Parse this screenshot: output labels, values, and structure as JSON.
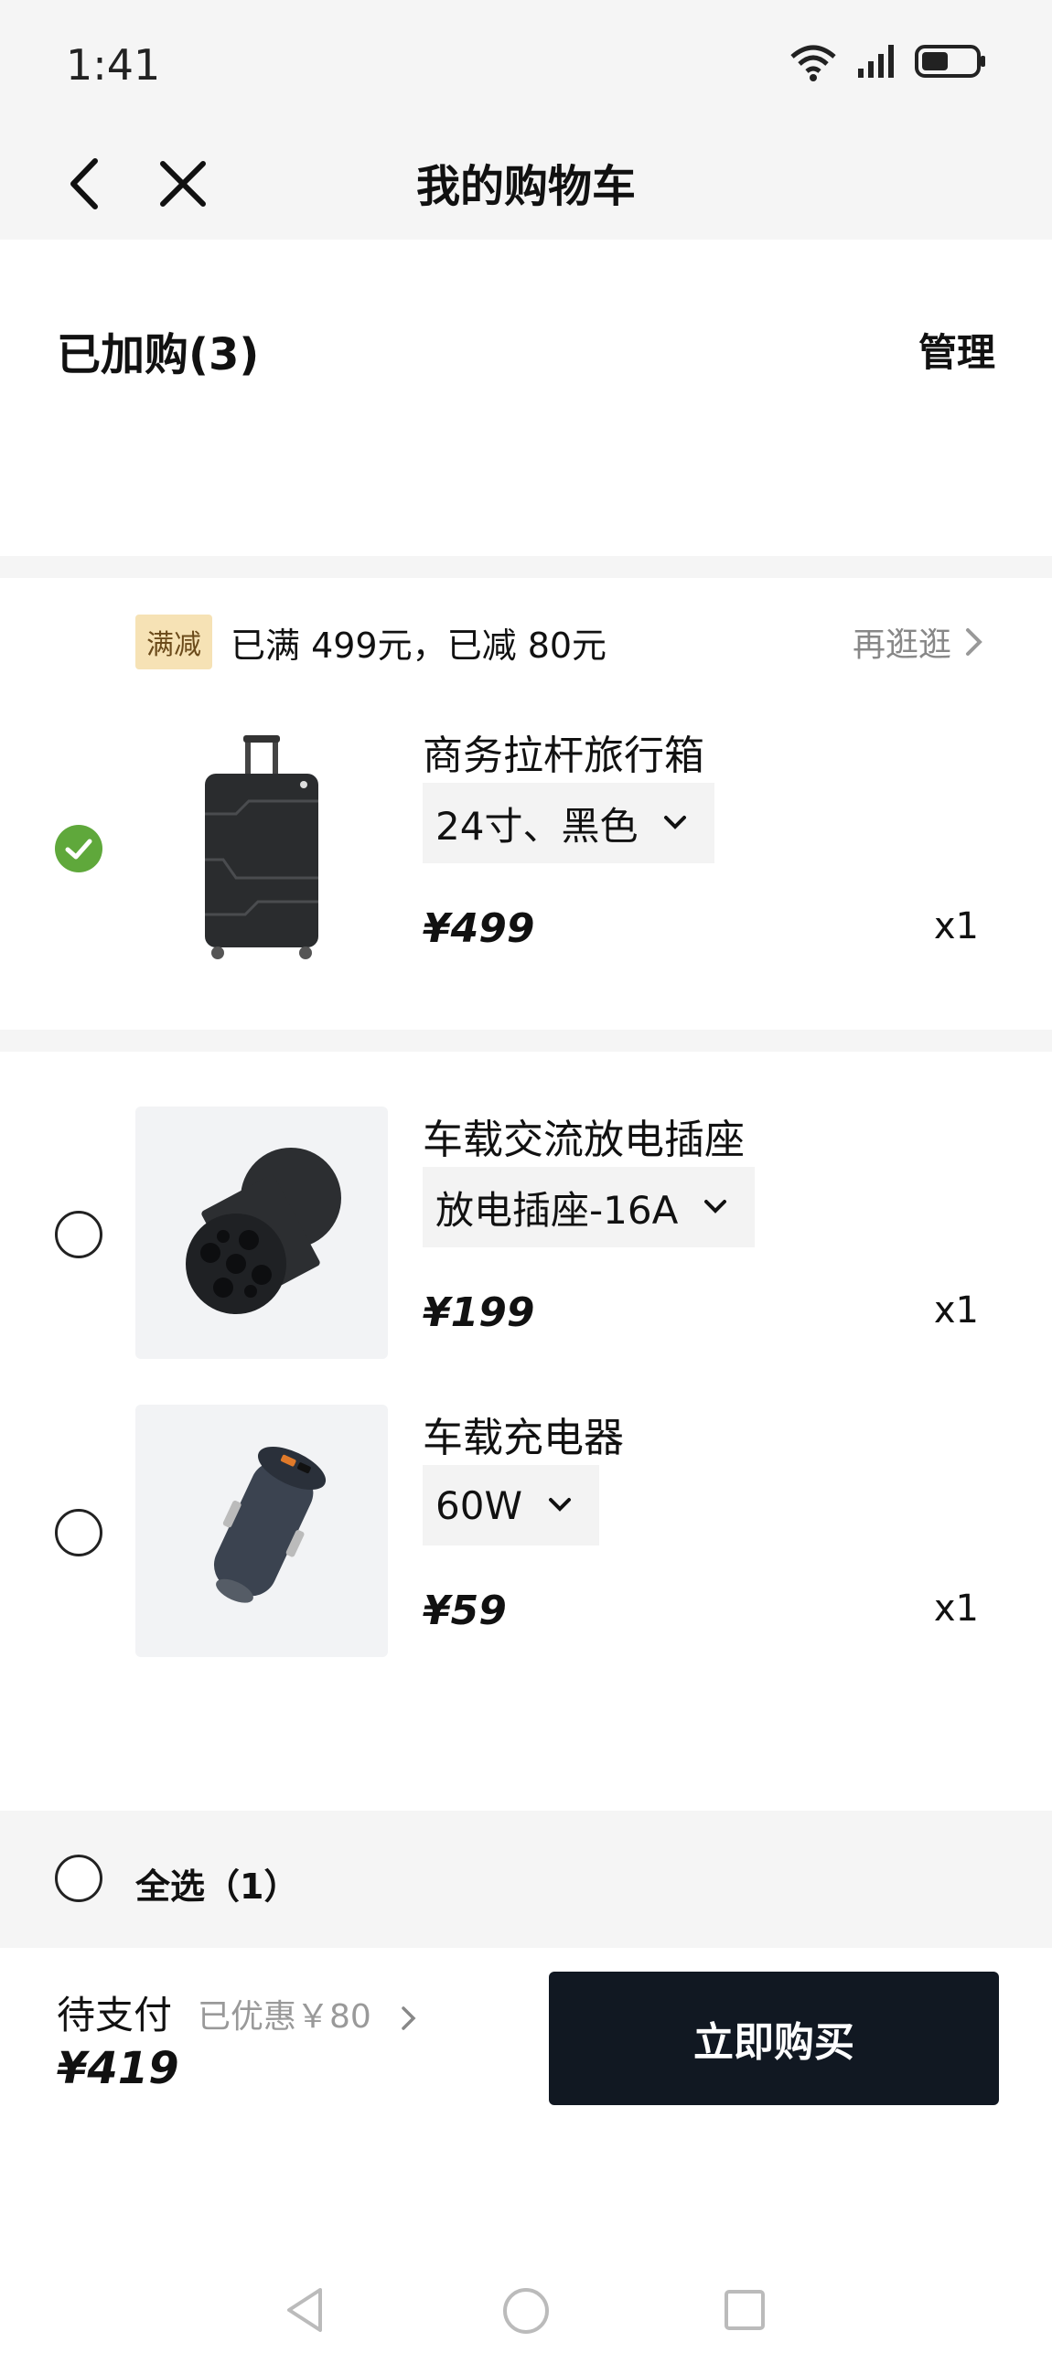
{
  "status": {
    "time": "1:41"
  },
  "nav": {
    "title": "我的购物车",
    "back_icon": "back-arrow-icon",
    "close_icon": "close-icon"
  },
  "header": {
    "count_label": "已加购(3)",
    "manage_label": "管理"
  },
  "promo": {
    "badge": "满减",
    "text": "已满 499元，已减 80元",
    "more_label": "再逛逛"
  },
  "items": [
    {
      "name": "商务拉杆旅行箱",
      "spec": "24寸、黑色",
      "price": "¥499",
      "qty": "x1",
      "selected": true
    },
    {
      "name": "车载交流放电插座",
      "spec": "放电插座-16A",
      "price": "¥199",
      "qty": "x1",
      "selected": false
    },
    {
      "name": "车载充电器",
      "spec": "60W",
      "price": "¥59",
      "qty": "x1",
      "selected": false
    }
  ],
  "footer": {
    "select_all_label": "全选（1）",
    "pay_label": "待支付",
    "discount_label": "已优惠￥80",
    "total": "¥419",
    "buy_label": "立即购买"
  },
  "colors": {
    "check_on": "#5fa83b",
    "buy_button": "#111822",
    "promo_badge": "#f6e2b5"
  }
}
